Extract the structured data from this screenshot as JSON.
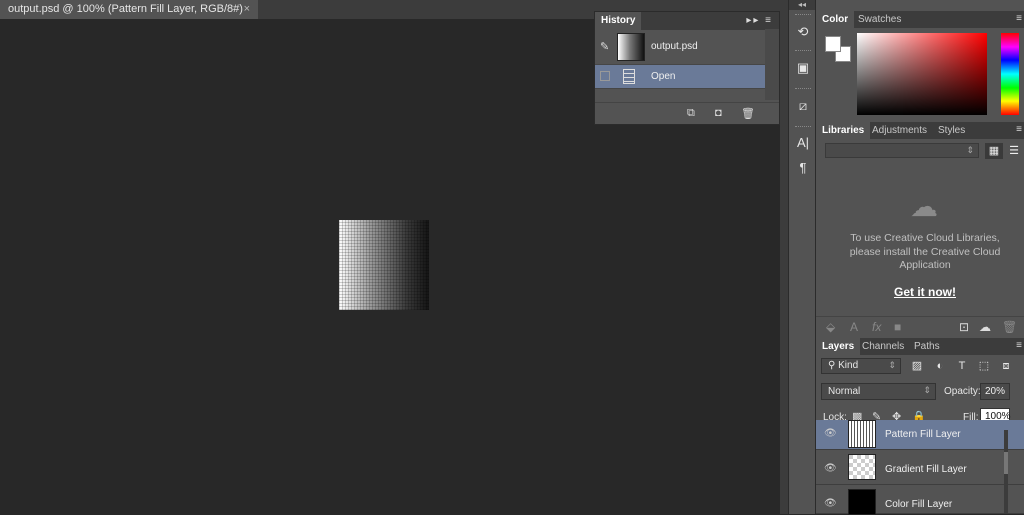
{
  "document": {
    "tab_title": "output.psd @ 100% (Pattern Fill Layer, RGB/8#)",
    "close_glyph": "×"
  },
  "history": {
    "panel_title": "History",
    "snapshot_name": "output.psd",
    "states": [
      {
        "label": "Open",
        "selected": true
      }
    ]
  },
  "color_panel": {
    "tabs": [
      "Color",
      "Swatches"
    ],
    "foreground": "#ffffff",
    "background": "#ffffff"
  },
  "libraries_panel": {
    "tabs": [
      "Libraries",
      "Adjustments",
      "Styles"
    ],
    "message": "To use Creative Cloud Libraries, please install the Creative Cloud Application",
    "link": "Get it now!"
  },
  "layers_panel": {
    "tabs": [
      "Layers",
      "Channels",
      "Paths"
    ],
    "filter_kind": "Kind",
    "blend_mode": "Normal",
    "opacity_label": "Opacity:",
    "opacity_value": "20%",
    "lock_label": "Lock:",
    "fill_label": "Fill:",
    "fill_value": "100%",
    "layers": [
      {
        "name": "Pattern Fill Layer",
        "selected": true
      },
      {
        "name": "Gradient Fill Layer",
        "selected": false
      },
      {
        "name": "Color Fill Layer",
        "selected": false
      }
    ]
  },
  "colors": {
    "selection": "#6a7a98",
    "panel": "#535353",
    "workspace": "#282828"
  }
}
